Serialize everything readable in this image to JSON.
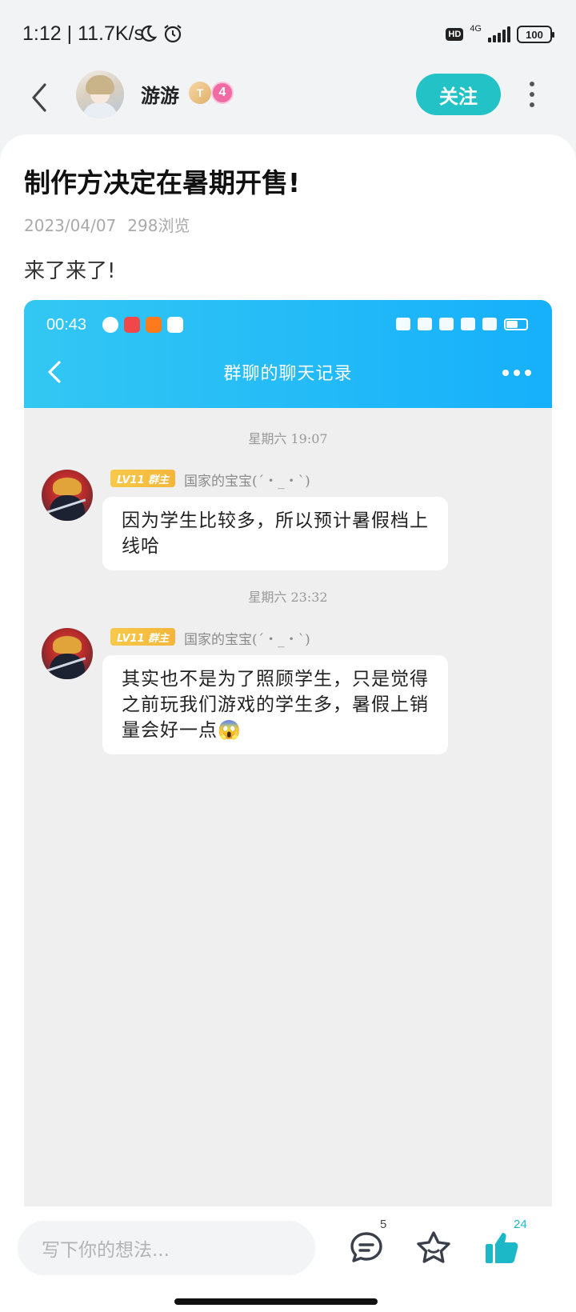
{
  "status_bar": {
    "time": "1:12 | 11.7K/s",
    "network": "4G",
    "battery": "100"
  },
  "header": {
    "username": "游游",
    "tier_badge": "T",
    "level": "4",
    "follow_label": "关注"
  },
  "post": {
    "title": "制作方决定在暑期开售!",
    "date": "2023/04/07",
    "views": "298浏览",
    "body": "来了来了!"
  },
  "screenshot": {
    "time": "00:43",
    "title": "群聊的聊天记录",
    "messages": [
      {
        "timestamp": "星期六 19:07",
        "badge": "LV11 群主",
        "sender": "国家的宝宝(´・_・`)",
        "text": "因为学生比较多，所以预计暑假档上线哈"
      },
      {
        "timestamp": "星期六 23:32",
        "badge": "LV11 群主",
        "sender": "国家的宝宝(´・_・`)",
        "text": "其实也不是为了照顾学生，只是觉得之前玩我们游戏的学生多，暑假上销量会好一点😱"
      }
    ]
  },
  "bottom_bar": {
    "input_placeholder": "写下你的想法...",
    "comment_count": "5",
    "like_count": "24"
  },
  "colors": {
    "accent": "#23c2c6",
    "like": "#1cb8c8",
    "chat_header": "#16b0fb"
  }
}
